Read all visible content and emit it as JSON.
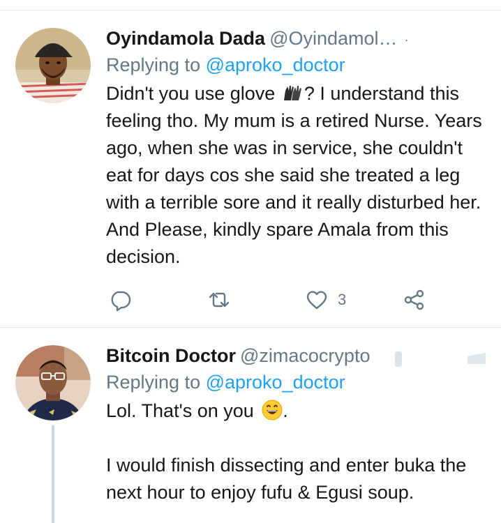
{
  "tweets": [
    {
      "display_name": "Oyindamola Dada",
      "handle": "@Oyindamol…",
      "dot": "·",
      "replying_prefix": "Replying to ",
      "replying_to": "@aproko_doctor",
      "text_part1": "Didn't you use glove ",
      "emoji1": "gloves",
      "text_part2": "? I understand this feeling tho. My mum is a retired Nurse. Years ago, when she was in service, she couldn't eat for days cos she said she treated a leg with a terrible sore and it really disturbed her. And Please, kindly spare Amala from this decision.",
      "actions": {
        "reply_icon": "reply-icon",
        "retweet_icon": "retweet-icon",
        "like_icon": "heart-icon",
        "like_count": "3",
        "share_icon": "share-icon"
      }
    },
    {
      "display_name": "Bitcoin Doctor",
      "handle": "@zimacocrypto",
      "replying_prefix": "Replying to ",
      "replying_to": "@aproko_doctor",
      "line1": "Lol. That's on you ",
      "emoji": "grinning-face",
      "line1_end": ".",
      "line2": "I would finish dissecting and enter buka the next hour to enjoy fufu & Egusi soup."
    }
  ],
  "colors": {
    "link": "#1da1f2",
    "secondary": "#657786",
    "text": "#14171a",
    "divider": "#e1e8ed"
  }
}
